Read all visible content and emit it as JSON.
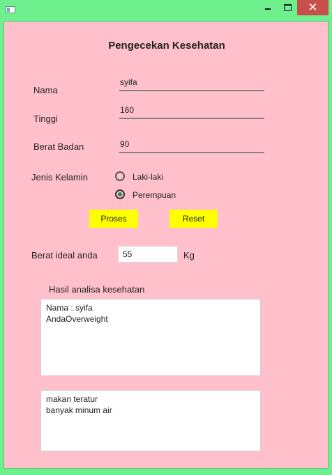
{
  "window": {
    "minimize_glyph": "",
    "maximize_glyph": "",
    "close_glyph": "✕",
    "icon": "app-window-icon"
  },
  "form": {
    "title": "Pengecekan Kesehatan",
    "nama_label": "Nama",
    "nama_value": "syifa",
    "tinggi_label": "Tinggi",
    "tinggi_value": "160",
    "berat_label": "Berat Badan",
    "berat_value": "90",
    "gender_label": "Jenis Kelamin",
    "gender_options": [
      {
        "label": "Laki-laki",
        "selected": false
      },
      {
        "label": "Perempuan",
        "selected": true
      }
    ],
    "proses_label": "Proses",
    "reset_label": "Reset",
    "ideal_label": "Berat ideal anda",
    "ideal_value": "55",
    "ideal_unit": "Kg",
    "hasil_label": "Hasil analisa kesehatan",
    "hasil_lines": [
      "Nama : syifa",
      "AndaOverweight"
    ],
    "saran_lines": [
      "",
      "makan teratur",
      "banyak minum air"
    ]
  },
  "colors": {
    "window_bg": "#6ff08f",
    "panel_bg": "#ffc0cb",
    "button_bg": "#ffff00",
    "close_bg": "#c7504c",
    "radio_selected": "#1f8f4f"
  }
}
